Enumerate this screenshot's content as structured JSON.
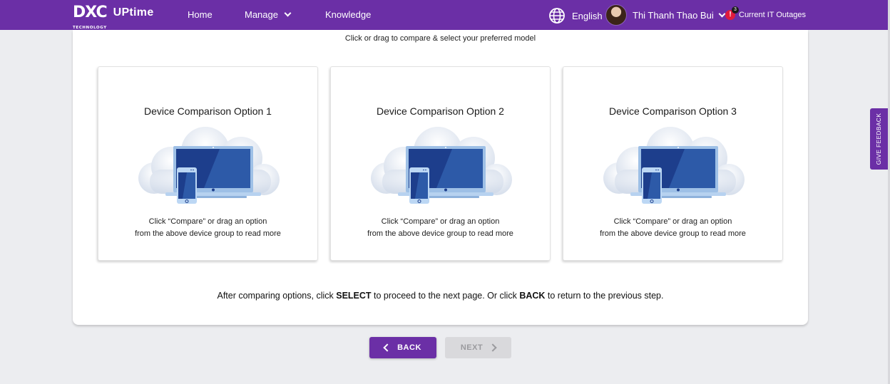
{
  "header": {
    "logo_main": "DXC",
    "logo_sub": "TECHNOLOGY",
    "app_name": "UPtime",
    "nav": {
      "home": "Home",
      "manage": "Manage",
      "knowledge": "Knowledge"
    },
    "language": "English",
    "user_name": "Thi Thanh Thao Bui",
    "alert_icon": "!",
    "alert_count": "3",
    "outages_label": "Current IT Outages"
  },
  "main": {
    "instruction": "Click or drag to compare & select your preferred model",
    "options": [
      {
        "title": "Device Comparison Option 1",
        "desc_line1": "Click “Compare” or drag an option",
        "desc_line2": "from the above device group to read more"
      },
      {
        "title": "Device Comparison Option 2",
        "desc_line1": "Click “Compare” or drag an option",
        "desc_line2": "from the above device group to read more"
      },
      {
        "title": "Device Comparison Option 3",
        "desc_line1": "Click “Compare” or drag an option",
        "desc_line2": "from the above device group to read more"
      }
    ],
    "footer": {
      "part1": "After comparing options, click ",
      "select_word": "SELECT",
      "part2": " to proceed to the next page. Or click ",
      "back_word": "BACK",
      "part3": " to return to the previous step."
    }
  },
  "buttons": {
    "back": "BACK",
    "next": "NEXT"
  },
  "feedback_label": "GIVE FEEDBACK",
  "colors": {
    "brand_purple": "#6b2fa6",
    "alert_red": "#e01b3c",
    "disabled_gray": "#d9d9dc"
  },
  "icons": [
    "globe-icon",
    "chevron-down-icon",
    "alert-icon",
    "chevron-left-icon",
    "chevron-right-icon",
    "device-cloud-illustration"
  ]
}
